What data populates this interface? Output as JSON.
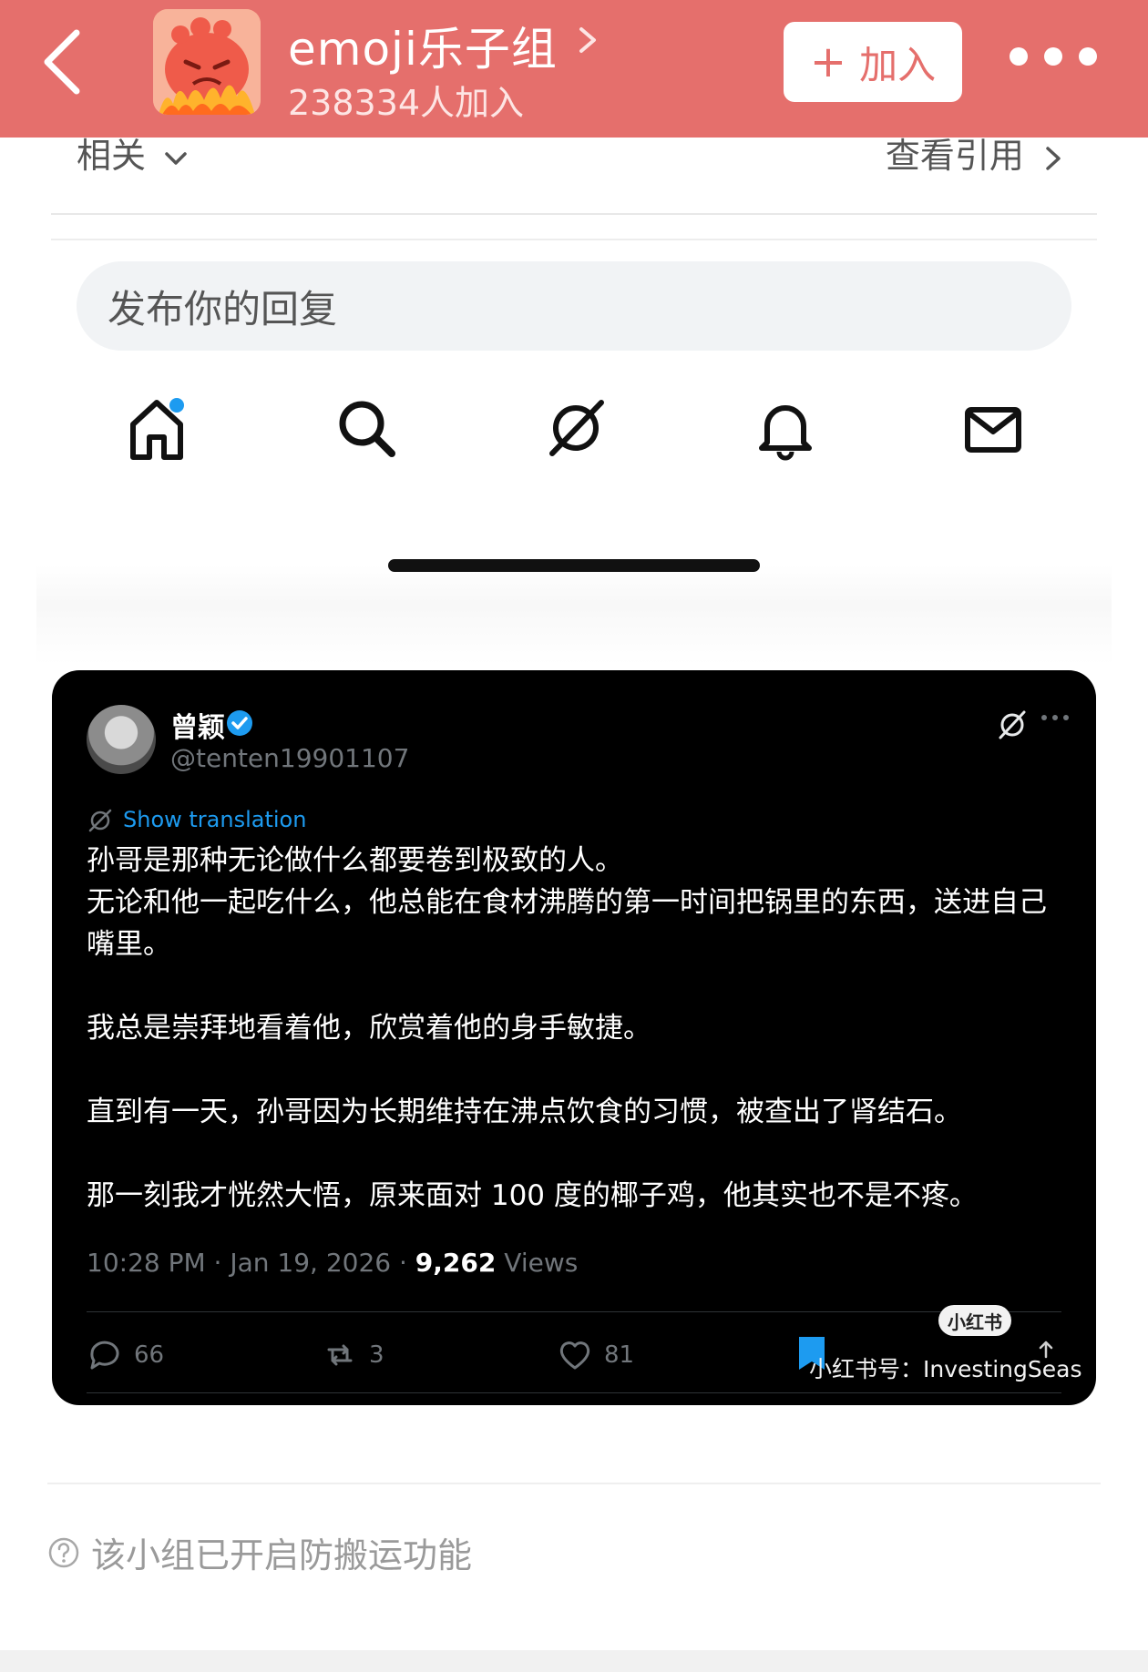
{
  "group": {
    "name": "emoji乐子组",
    "members": "238334人加入",
    "join_label": "加入",
    "join_plus": "+",
    "brand_color": "#e56f6c"
  },
  "tweet_page": {
    "related_label": "相关",
    "quotes_label": "查看引用",
    "reply_placeholder": "发布你的回复",
    "tabs": [
      "home-icon",
      "search-icon",
      "grok-icon",
      "bell-icon",
      "mail-icon"
    ]
  },
  "tweet": {
    "author": "曾颖",
    "handle": "@tenten19901107",
    "translate_label": "Show translation",
    "paragraphs": [
      "孙哥是那种无论做什么都要卷到极致的人。",
      "无论和他一起吃什么，他总能在食材沸腾的第一时间把锅里的东西，送进自己嘴里。",
      "我总是崇拜地看着他，欣赏着他的身手敏捷。",
      "直到有一天，孙哥因为长期维持在沸点饮食的习惯，被查出了肾结石。",
      "那一刻我才恍然大悟，原来面对 100 度的椰子鸡，他其实也不是不疼。"
    ],
    "time": "10:28 PM · Jan 19, 2026 · ",
    "views_count": "9,262",
    "views_label": " Views",
    "replies": "66",
    "reposts": "3",
    "likes": "81"
  },
  "watermark": {
    "badge": "小红书",
    "text": "小红书号：InvestingSeas"
  },
  "footer": {
    "notice": "该小组已开启防搬运功能"
  }
}
